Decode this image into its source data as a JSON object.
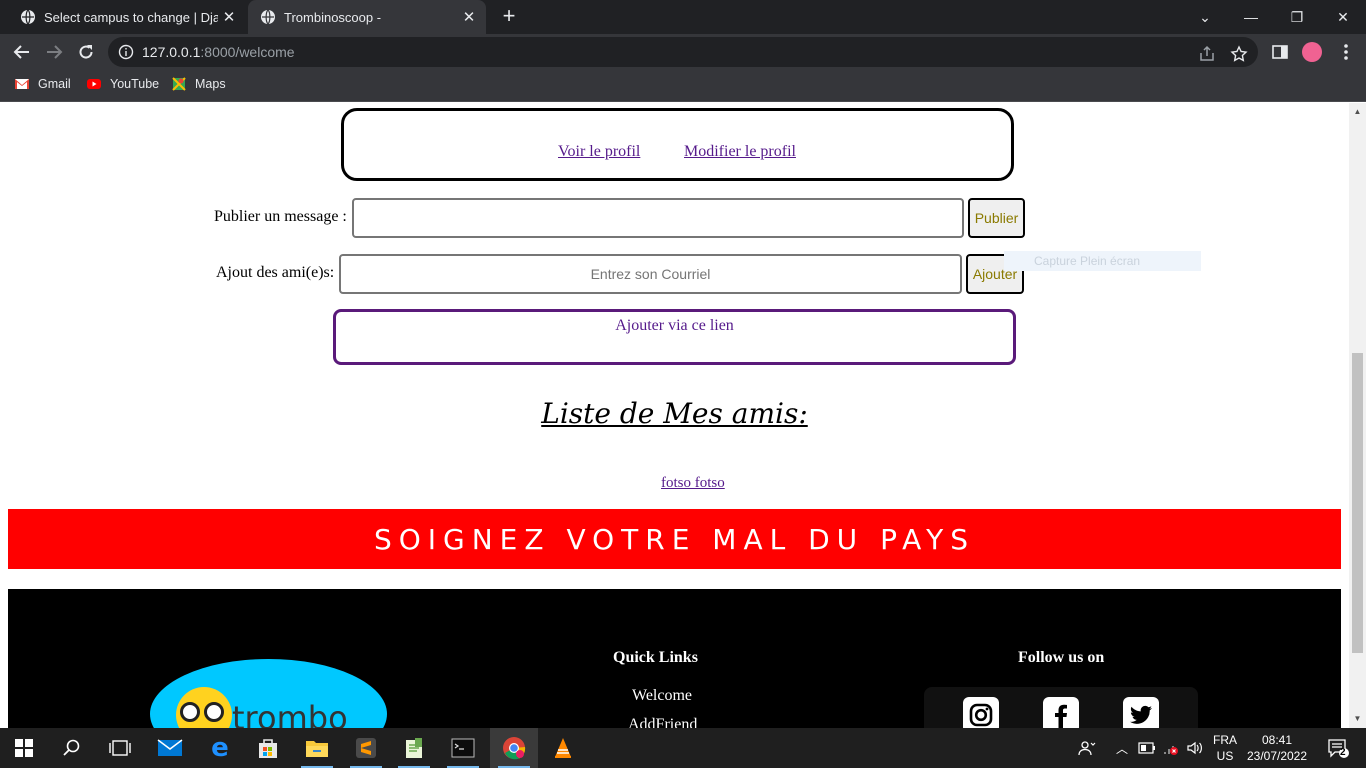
{
  "browser": {
    "tabs": [
      {
        "title": "Select campus to change | Django",
        "active": false
      },
      {
        "title": "Trombinoscoop -",
        "active": true
      }
    ],
    "url_host": "127.0.0.1",
    "url_path": ":8000/welcome",
    "bookmarks": [
      {
        "label": "Gmail",
        "icon": "gmail-icon"
      },
      {
        "label": "YouTube",
        "icon": "youtube-icon"
      },
      {
        "label": "Maps",
        "icon": "maps-icon"
      }
    ]
  },
  "page": {
    "profile_links": {
      "view": "Voir le profil",
      "edit": "Modifier le profil"
    },
    "publish": {
      "label": "Publier un message :",
      "value": "",
      "button": "Publier"
    },
    "add_friend": {
      "label": "Ajout des ami(e)s:",
      "placeholder": "Entrez son Courriel",
      "button": "Ajouter"
    },
    "capture_tip": "Capture Plein écran",
    "add_via_link": "Ajouter via ce lien",
    "friends_title": "Liste de Mes amis:",
    "friends": [
      "fotso fotso"
    ],
    "banner": "SOIGNEZ VOTRE MAL DU PAYS"
  },
  "footer": {
    "logo_text": "trombo",
    "quick_links_title": "Quick Links",
    "quick_links": [
      "Welcome",
      "AddFriend"
    ],
    "follow_title": "Follow us on",
    "social": [
      "instagram-icon",
      "facebook-icon",
      "twitter-icon"
    ]
  },
  "taskbar": {
    "language": "FRA",
    "layout": "US",
    "time": "08:41",
    "date": "23/07/2022",
    "notifications": "2"
  },
  "colors": {
    "link": "#551a8b",
    "banner": "#ff0000",
    "logo_bg": "#00c8ff",
    "button_text": "#8a7a00"
  }
}
